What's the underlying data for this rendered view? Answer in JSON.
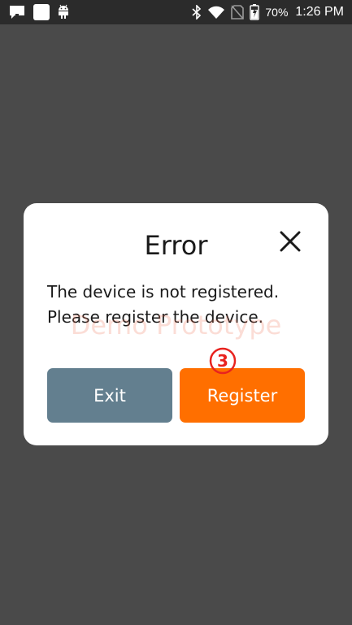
{
  "status_bar": {
    "left_icons": [
      "message-icon",
      "square-notification-icon",
      "android-icon"
    ],
    "right_icons": [
      "bluetooth-icon",
      "wifi-icon",
      "no-sim-icon",
      "battery-icon"
    ],
    "battery": "70%",
    "time": "1:26 PM"
  },
  "dialog": {
    "title": "Error",
    "message_line1": "The device is not registered.",
    "message_line2": "Please register the device.",
    "close_icon": "close-icon",
    "exit_label": "Exit",
    "register_label": "Register"
  },
  "overlay": {
    "watermark": "Demo Prototype",
    "step_marker": "③"
  },
  "colors": {
    "backdrop": "#4a4a4a",
    "status_bar": "#2b2b2b",
    "exit_button": "#637f8f",
    "register_button": "#ff6f00",
    "step_marker": "#e8231f"
  }
}
